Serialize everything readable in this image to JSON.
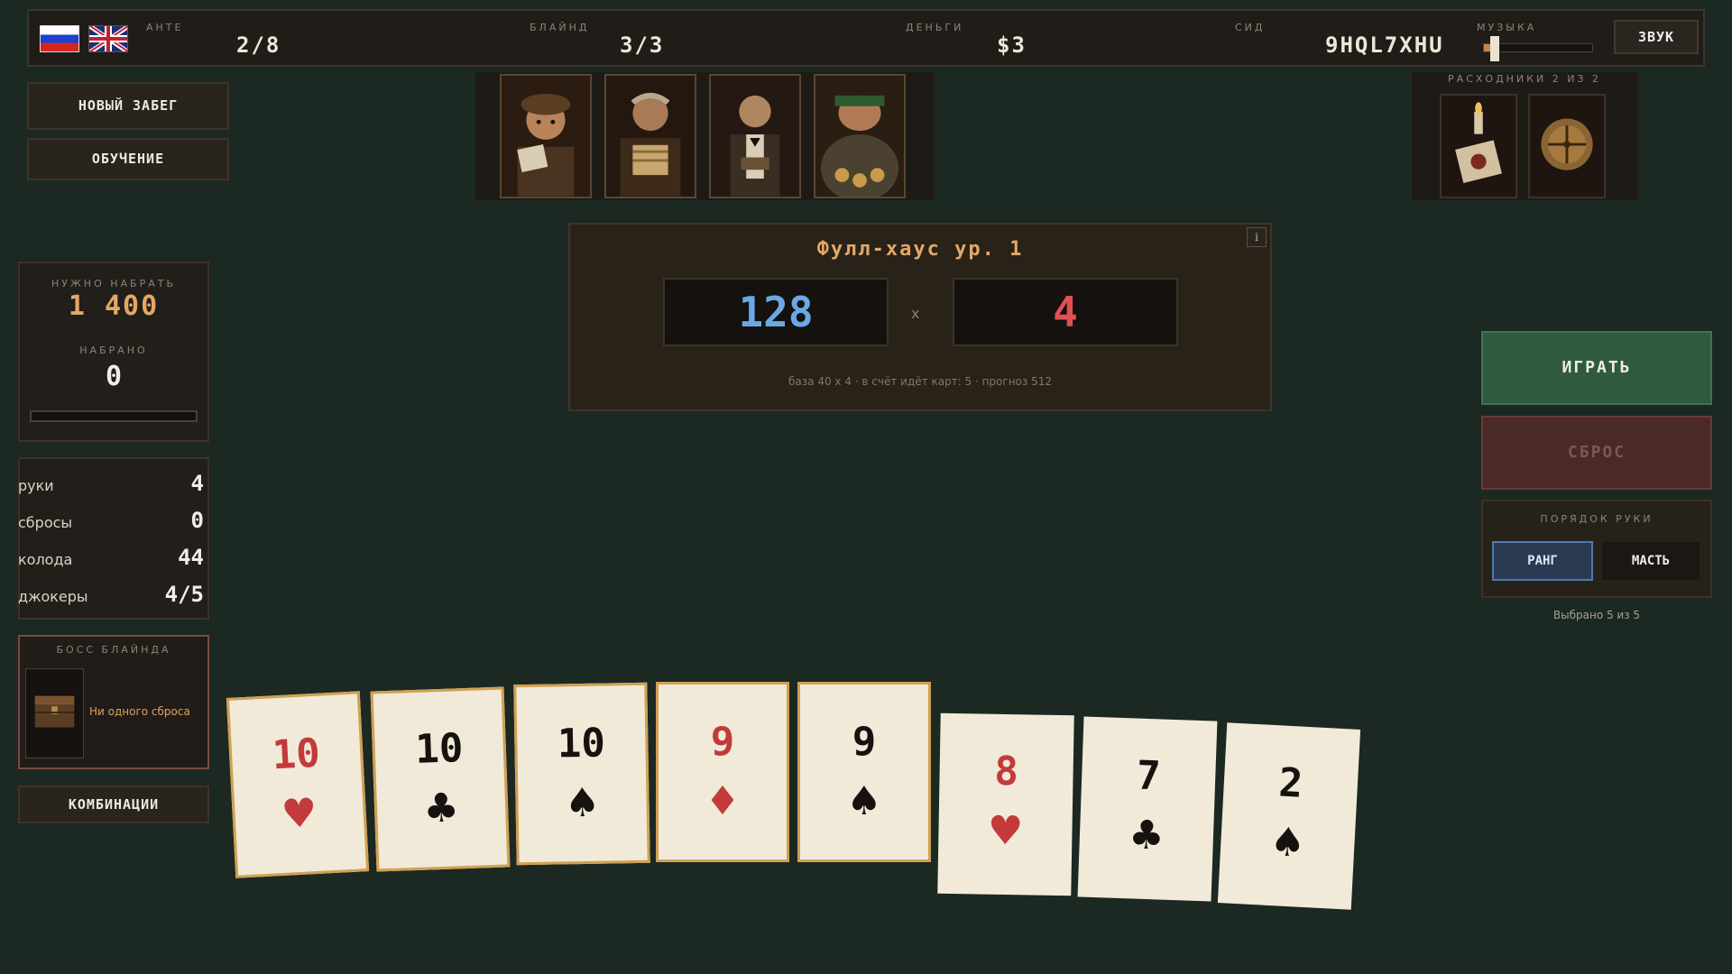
{
  "topbar": {
    "ante_label": "АНТЕ",
    "ante_value": "2/8",
    "blind_label": "БЛАЙНД",
    "blind_value": "3/3",
    "money_label": "ДЕНЬГИ",
    "money_value": "$3",
    "seed_label": "СИД",
    "seed_value": "9HQL7XHU",
    "music_label": "МУЗЫКА",
    "music_volume": 0.06,
    "sound_label": "ЗВУК"
  },
  "menu": {
    "new_run": "НОВЫЙ ЗАБЕГ",
    "tutorial": "ОБУЧЕНИЕ"
  },
  "consumables": {
    "label": "РАСХОДНИКИ 2 ИЗ 2"
  },
  "hand_info": {
    "title": "Фулл-хаус   ур. 1",
    "chips": "128",
    "times": "x",
    "mult": "4",
    "info": "i",
    "footer": "база 40 x 4   ·   в счёт идёт карт: 5   ·   прогноз  512"
  },
  "target": {
    "need_label": "НУЖНО НАБРАТЬ",
    "need_value": "1 400",
    "scored_label": "НАБРАНО",
    "scored_value": "0",
    "progress": 0
  },
  "counts": [
    {
      "label": "руки",
      "value": "4"
    },
    {
      "label": "сбросы",
      "value": "0"
    },
    {
      "label": "колода",
      "value": "44"
    },
    {
      "label": "джокеры",
      "value": "4/5"
    }
  ],
  "boss": {
    "label": "БОСС БЛАЙНДА",
    "text": "Ни одного сброса"
  },
  "combos_label": "КОМБИНАЦИИ",
  "actions": {
    "play": "ИГРАТЬ",
    "discard": "СБРОС"
  },
  "sort": {
    "label": "ПОРЯДОК РУКИ",
    "rank": "РАНГ",
    "suit": "МАСТЬ",
    "selected_note": "Выбрано 5 из 5"
  },
  "colors": {
    "background": "#1c2822",
    "accent": "#e3a866",
    "chips": "#6aa8e6",
    "mult": "#e05050",
    "play": "#2f5a40",
    "discard": "#4a2a27"
  },
  "hand_cards": [
    {
      "rank": "10",
      "suit": "♥",
      "color": "red",
      "selected": true
    },
    {
      "rank": "10",
      "suit": "♣",
      "color": "black",
      "selected": true
    },
    {
      "rank": "10",
      "suit": "♠",
      "color": "black",
      "selected": true
    },
    {
      "rank": "9",
      "suit": "♦",
      "color": "red",
      "selected": true
    },
    {
      "rank": "9",
      "suit": "♠",
      "color": "black",
      "selected": true
    },
    {
      "rank": "8",
      "suit": "♥",
      "color": "red",
      "selected": false
    },
    {
      "rank": "7",
      "suit": "♣",
      "color": "black",
      "selected": false
    },
    {
      "rank": "2",
      "suit": "♠",
      "color": "black",
      "selected": false
    }
  ]
}
